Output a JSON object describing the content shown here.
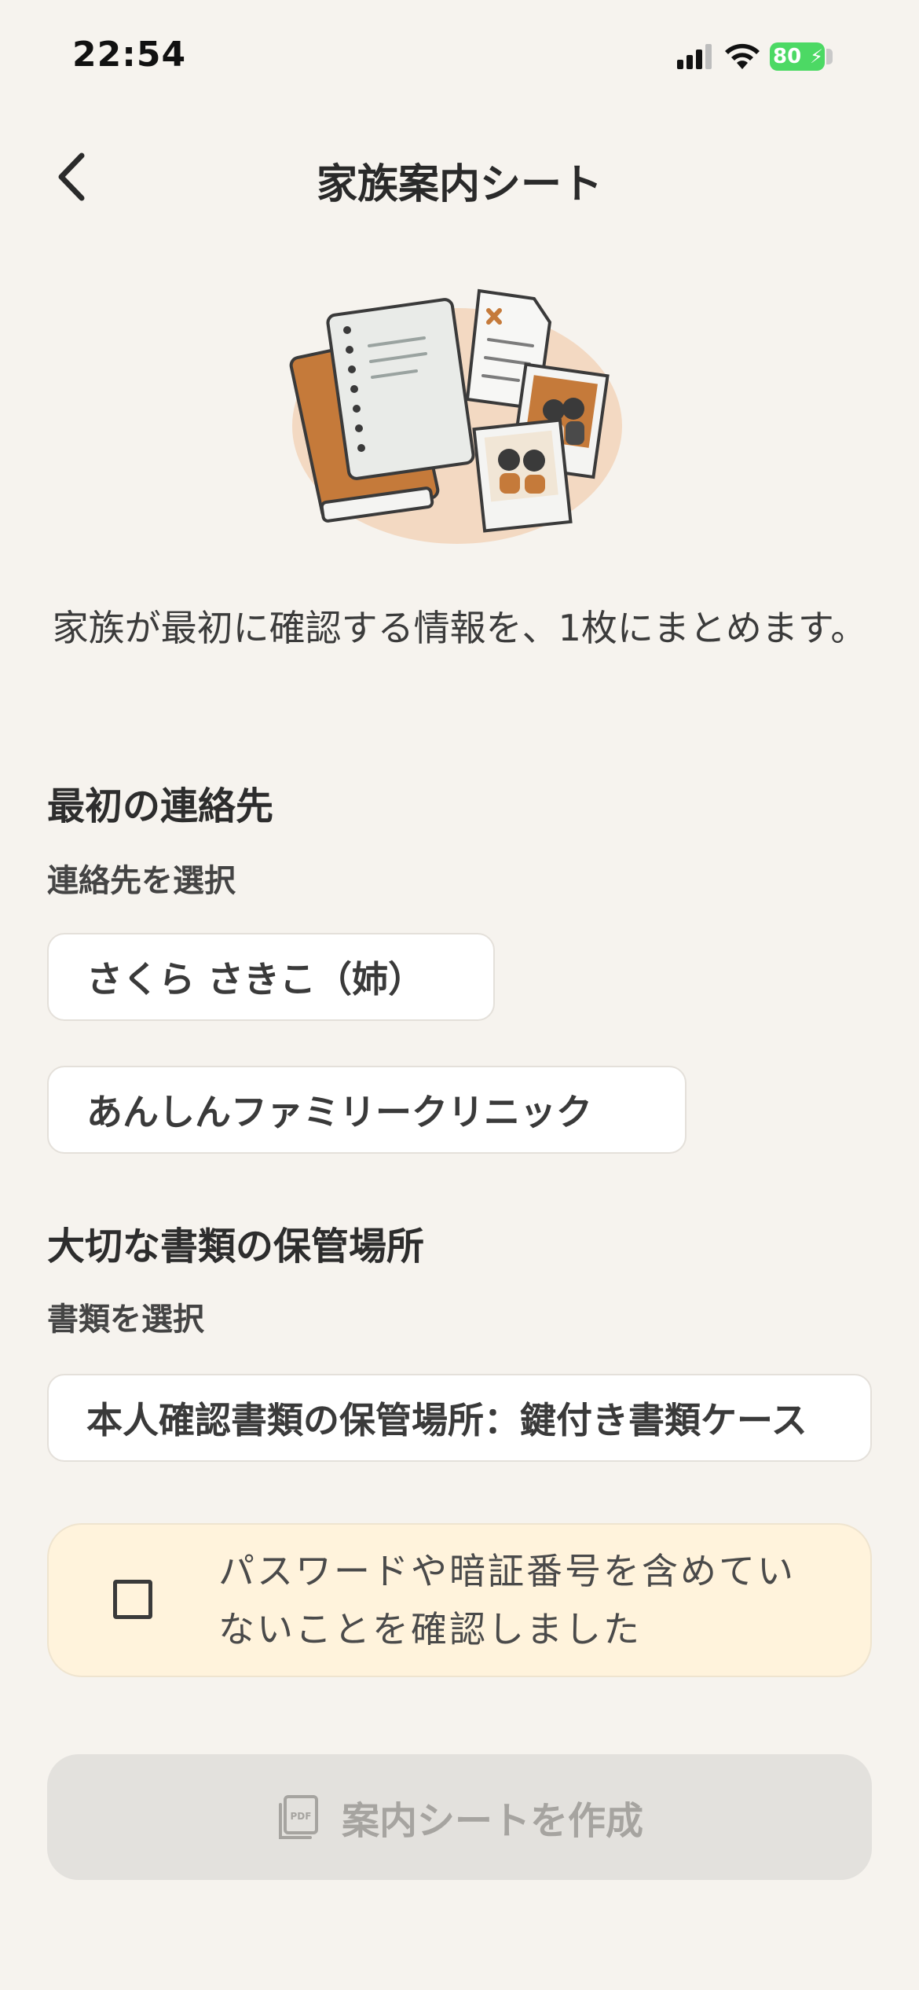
{
  "status_bar": {
    "time": "22:54",
    "battery": "80"
  },
  "header": {
    "title": "家族案内シート",
    "back_icon": "chevron-left-icon"
  },
  "intro": "家族が最初に確認する情報を、1枚にまとめます。",
  "contacts": {
    "title": "最初の連絡先",
    "subtitle": "連絡先を選択",
    "options": [
      "さくら さきこ（姉）",
      "あんしんファミリークリニック"
    ]
  },
  "documents": {
    "title": "大切な書類の保管場所",
    "subtitle": "書類を選択",
    "options": [
      "本人確認書類の保管場所：鍵付き書類ケース"
    ]
  },
  "confirmation": {
    "label": "パスワードや暗証番号を含めていないことを確認しました",
    "checked": false
  },
  "create_button": {
    "label": "案内シートを作成",
    "icon": "pdf-icon",
    "enabled": false
  },
  "colors": {
    "background": "#f6f3ee",
    "confirm_box": "#fff3dc",
    "disabled_button": "#e3e1dd",
    "battery": "#4cd964",
    "illustration_accent": "#c57a3a"
  }
}
